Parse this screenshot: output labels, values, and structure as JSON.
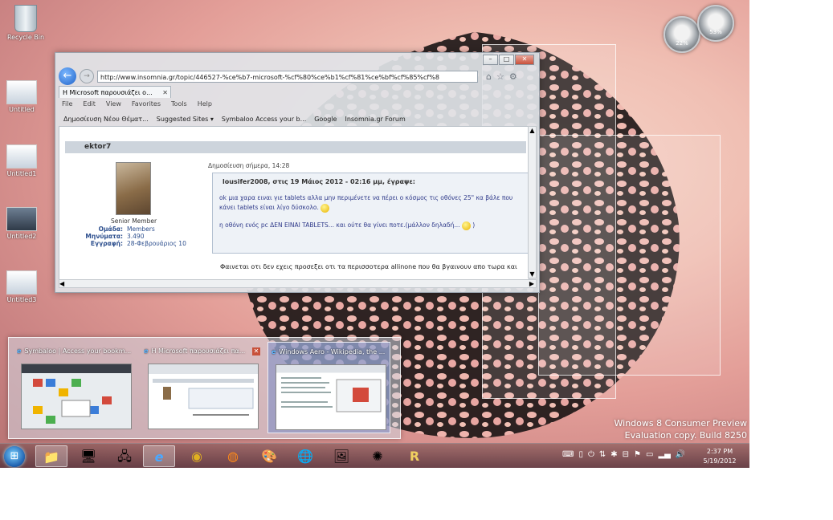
{
  "desktop": {
    "icons": [
      {
        "label": "Recycle Bin"
      },
      {
        "label": "Untitled"
      },
      {
        "label": "Untitled1"
      },
      {
        "label": "Untitled2"
      },
      {
        "label": "Untitled3"
      }
    ],
    "watermark": {
      "line1": "Windows 8 Consumer Preview",
      "line2": "Evaluation copy. Build 8250"
    },
    "gadget": {
      "value1": "22%",
      "value2": "53%"
    }
  },
  "browser": {
    "address": "http://www.insomnia.gr/topic/446527-%ce%b7-microsoft-%cf%80%ce%b1%cf%81%ce%bf%cf%85%cf%8",
    "tab_title": "Η Microsoft παρουσιάζει ο...",
    "menu": [
      "File",
      "Edit",
      "View",
      "Favorites",
      "Tools",
      "Help"
    ],
    "favorites": [
      "Δημοσίευση Νέου Θέματ...",
      "Suggested Sites ▾",
      "Symbaloo  Access your b...",
      "Google",
      "Insomnia.gr Forum"
    ],
    "post": {
      "author": "ektor7",
      "posted": "Δημοσίευση σήμερα, 14:28",
      "rank": "Senior Member",
      "group_label": "Ομάδα:",
      "group_value": "Members",
      "posts_label": "Μηνύματα:",
      "posts_value": "3.490",
      "joined_label": "Εγγραφή:",
      "joined_value": "28-Φεβρουάριος 10",
      "quote_header": "lousifer2008, στις 19 Μάιος 2012 - 02:16 μμ, έγραψε:",
      "quote_line1": "ok μια χαρα ειναι  γιε tablets αλλα μην περιμένετε να πέρει ο κόσμος τις οθόνες 25\" κα  βάλε που",
      "quote_line2": "κάνει tablets είναι λίγο δύσκολο.",
      "quote_line3": "η οθόνη ενός pc ΔΕΝ ΕΙΝΑΙ TABLETS... και ούτε θα γίνει ποτε.(μάλλον δηλαδή...",
      "reply": "Φαινεται οτι δεν εχεις προσεξει οτι τα περισσοτερα allinone που θα βγαινουν απο τωρα και"
    }
  },
  "switcher": [
    {
      "title": "Symbaloo | Access your bookm..."
    },
    {
      "title": "Η Microsoft παρουσιάζει πα..."
    },
    {
      "title": "Windows Aero - Wikipedia, the ..."
    }
  ],
  "clock": {
    "time": "2:37 PM",
    "date": "5/19/2012"
  }
}
